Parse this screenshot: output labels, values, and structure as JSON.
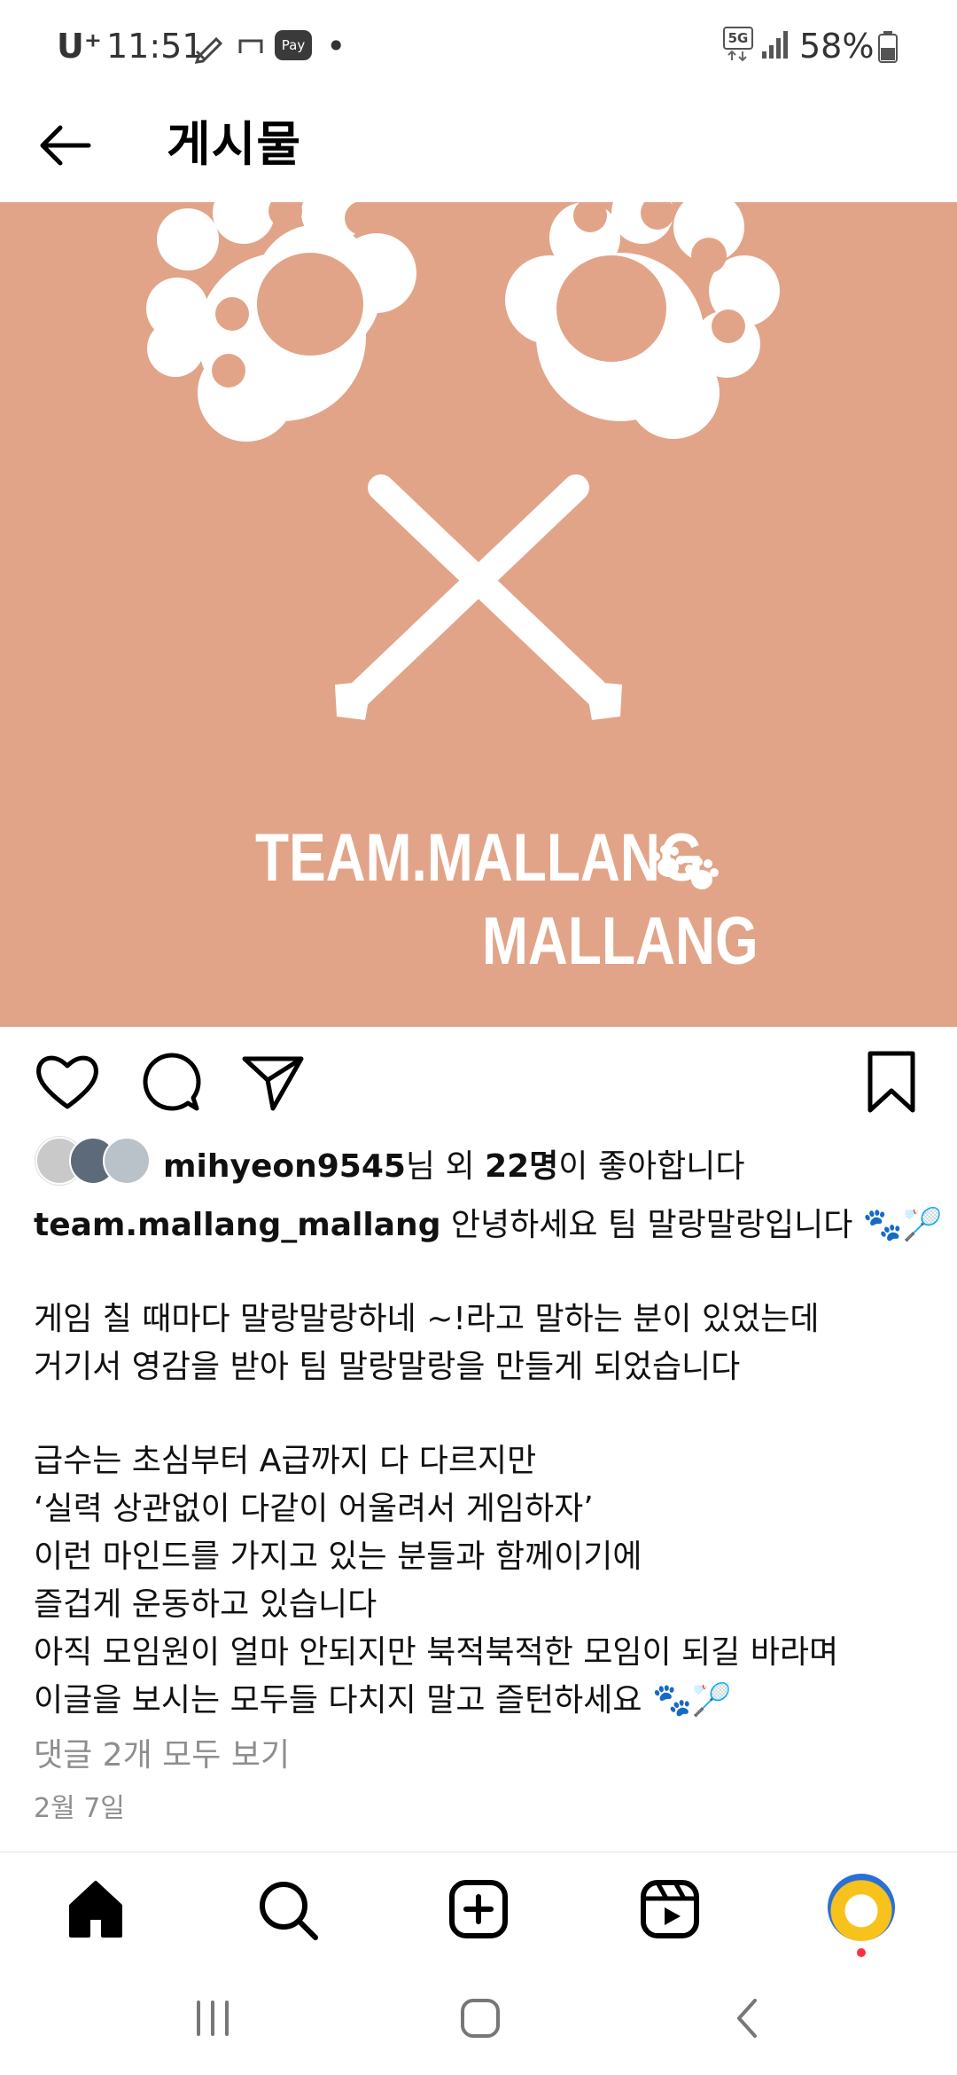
{
  "status": {
    "carrier": "U⁺",
    "time": "11:51",
    "pay": "Pay",
    "dot": "•",
    "network": "5G",
    "battery": "58%"
  },
  "header": {
    "title": "게시물",
    "back_icon": "arrow-left-icon"
  },
  "post": {
    "image": {
      "line1": "TEAM.MALLANG",
      "line2": "MALLANG",
      "background": "#e2a488"
    },
    "likes": {
      "user": "mihyeon9545",
      "middle": "님 외 ",
      "count": "22명",
      "suffix": "이 좋아합니다"
    },
    "caption": {
      "author": "team.mallang_mallang",
      "first": "안녕하세요 팀 말랑말랑입니다 🐾🏸",
      "lines": [
        "게임 칠 때마다 말랑말랑하네 ~!라고 말하는 분이 있었는데",
        "거기서 영감을 받아 팀 말랑말랑을 만들게 되었습니다",
        "급수는 초심부터 A급까지 다 다르지만",
        "‘실력 상관없이 다같이 어울려서 게임하자’",
        "이런 마인드를 가지고 있는 분들과 함께이기에",
        "즐겁게 운동하고 있습니다",
        "아직 모임원이 얼마 안되지만 북적북적한 모임이 되길 바라며",
        "이글을 보시는 모두들 다치지 말고 즐턴하세요 🐾🏸"
      ]
    },
    "comments_link": "댓글 2개 모두 보기",
    "date": "2월 7일"
  },
  "actions": [
    "heart-icon",
    "comment-icon",
    "share-icon",
    "bookmark-icon"
  ],
  "nav": [
    "home-icon",
    "search-icon",
    "create-icon",
    "reels-icon",
    "profile-avatar"
  ]
}
